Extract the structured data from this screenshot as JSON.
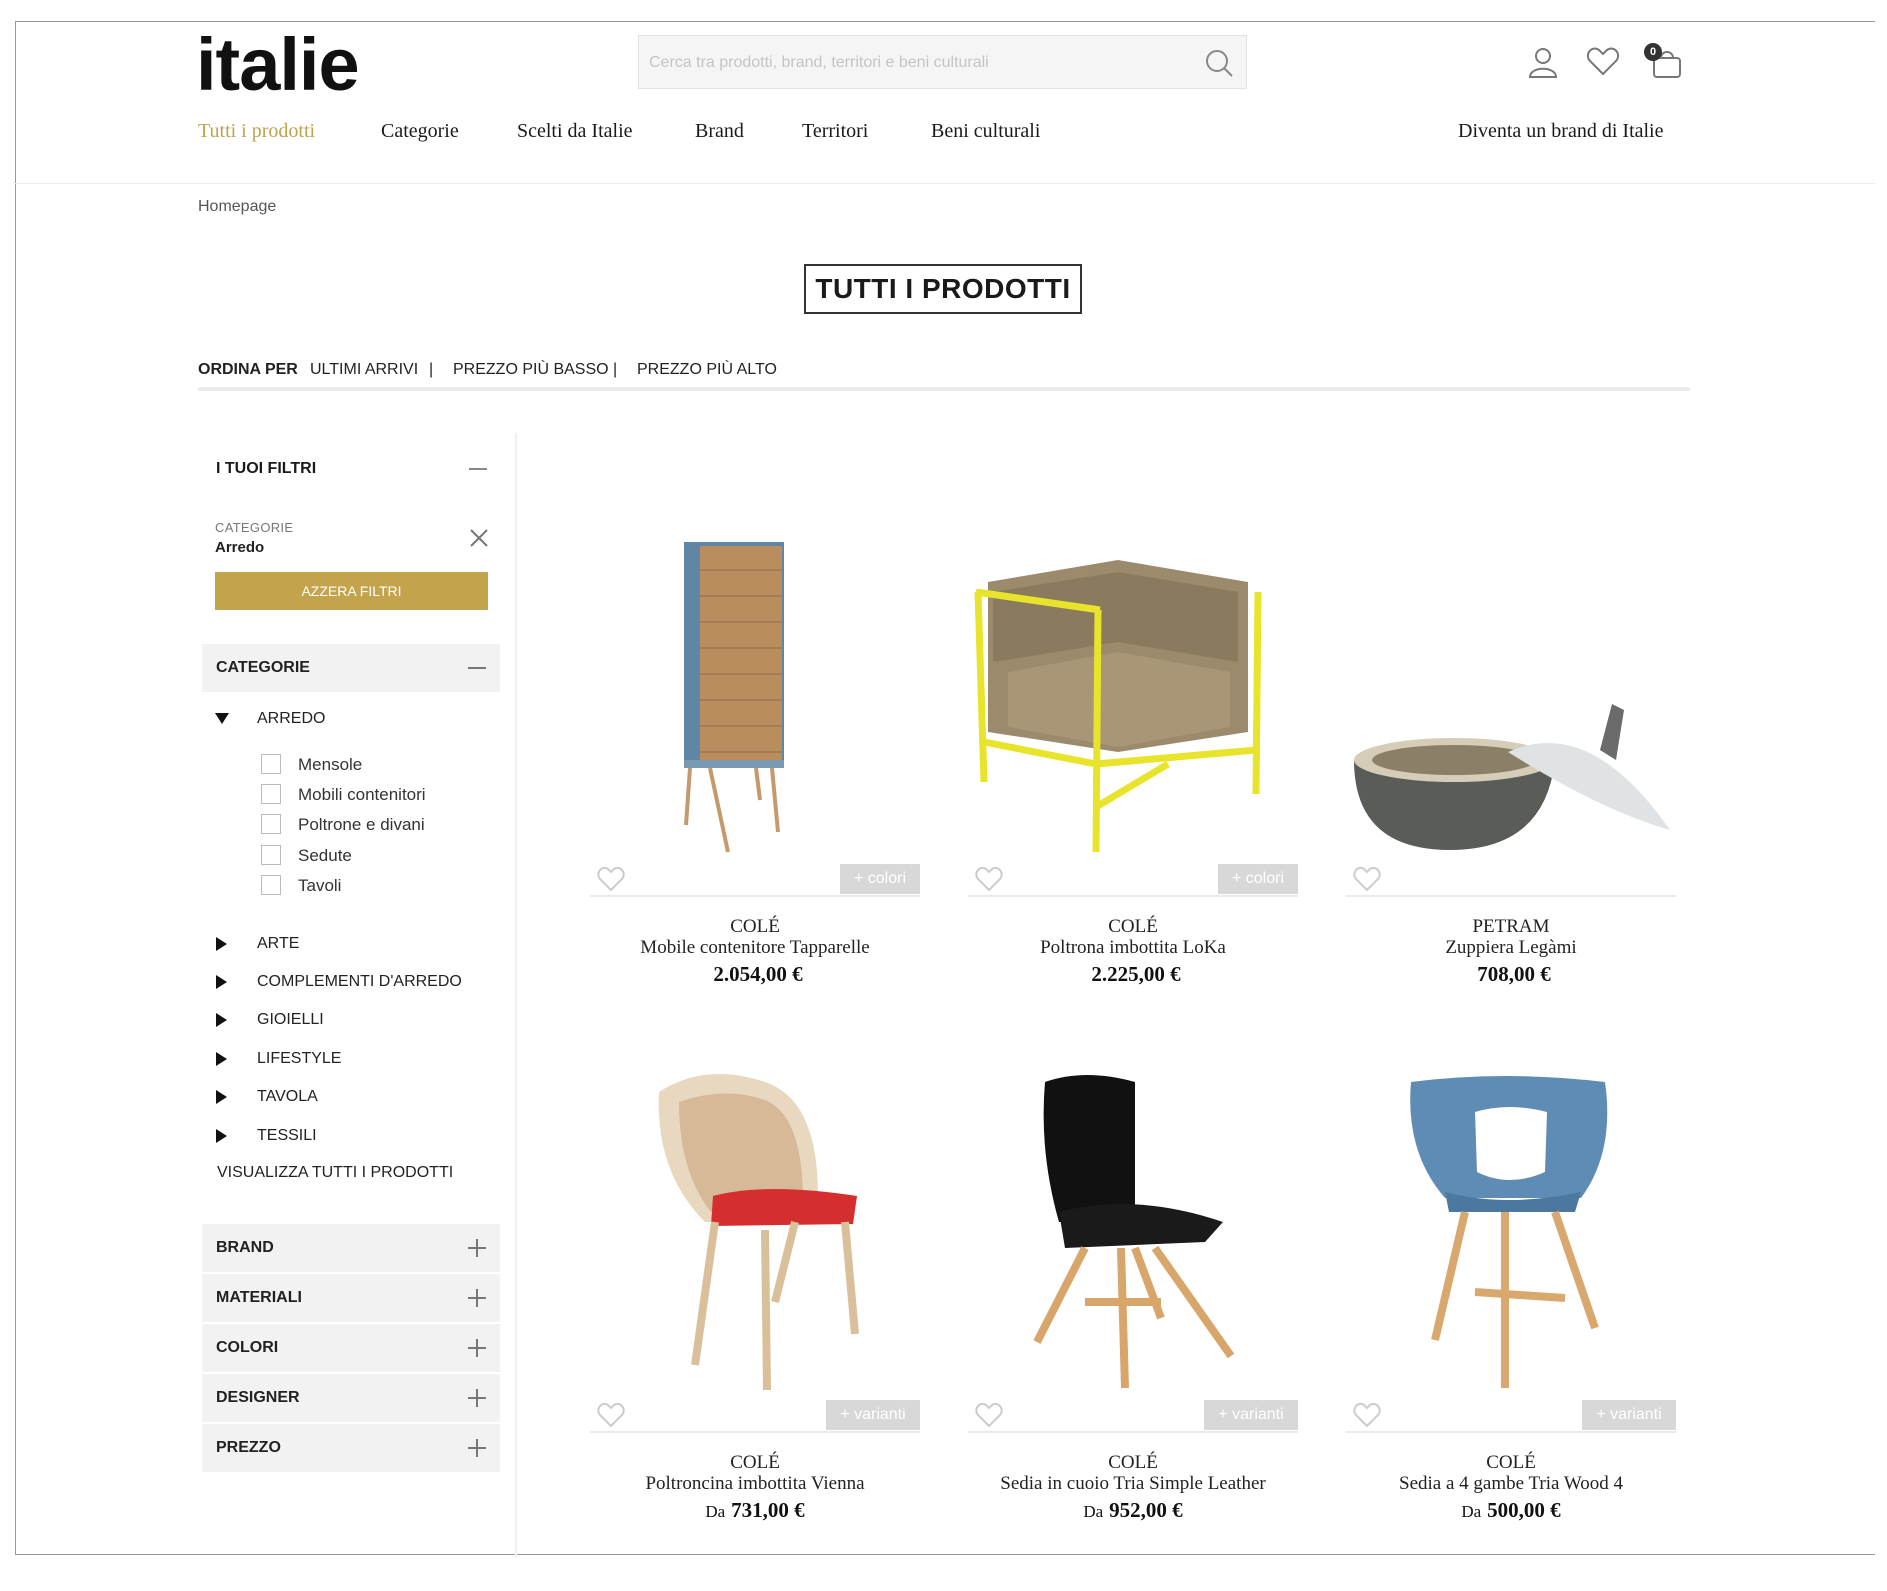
{
  "header": {
    "logo": "italie",
    "search_placeholder": "Cerca tra prodotti, brand, territori e beni culturali",
    "cart_count": "0",
    "nav": [
      "Tutti i prodotti",
      "Categorie",
      "Scelti da Italie",
      "Brand",
      "Territori",
      "Beni culturali"
    ],
    "cta": "Diventa un brand di Italie"
  },
  "breadcrumb": "Homepage",
  "page_title": "TUTTI I PRODOTTI",
  "sort": {
    "label": "ORDINA PER",
    "options": [
      "ULTIMI ARRIVI",
      "PREZZO PIÙ BASSO",
      "PREZZO PIÙ ALTO"
    ],
    "separator": "|"
  },
  "filters": {
    "your_filters": "I TUOI FILTRI",
    "active_label": "CATEGORIE",
    "active_value": "Arredo",
    "reset": "AZZERA FILTRI",
    "categories_title": "CATEGORIE",
    "expanded": "ARREDO",
    "subcategories": [
      "Mensole",
      "Mobili contenitori",
      "Poltrone e divani",
      "Sedute",
      "Tavoli"
    ],
    "collapsed": [
      "ARTE",
      "COMPLEMENTI D'ARREDO",
      "GIOIELLI",
      "LIFESTYLE",
      "TAVOLA",
      "TESSILI"
    ],
    "view_all": "VISUALIZZA TUTTI I PRODOTTI",
    "sections": [
      "BRAND",
      "MATERIALI",
      "COLORI",
      "DESIGNER",
      "PREZZO"
    ]
  },
  "products": [
    {
      "brand": "COLÉ",
      "name": "Mobile contenitore Tapparelle",
      "price": "2.054,00 €",
      "from": "",
      "variant": "+ colori"
    },
    {
      "brand": "COLÉ",
      "name": "Poltrona imbottita LoKa",
      "price": "2.225,00 €",
      "from": "",
      "variant": "+ colori"
    },
    {
      "brand": "PETRAM",
      "name": "Zuppiera Legàmi",
      "price": "708,00 €",
      "from": "",
      "variant": ""
    },
    {
      "brand": "COLÉ",
      "name": "Poltroncina imbottita Vienna",
      "price": "731,00 €",
      "from": "Da",
      "variant": "+ varianti"
    },
    {
      "brand": "COLÉ",
      "name": "Sedia in cuoio Tria Simple Leather",
      "price": "952,00 €",
      "from": "Da",
      "variant": "+ varianti"
    },
    {
      "brand": "COLÉ",
      "name": "Sedia a 4 gambe Tria Wood 4",
      "price": "500,00 €",
      "from": "Da",
      "variant": "+ varianti"
    }
  ],
  "colors": {
    "accent": "#c3a34c",
    "nav_active": "#c0a24d",
    "panel": "#f2f2f2"
  }
}
